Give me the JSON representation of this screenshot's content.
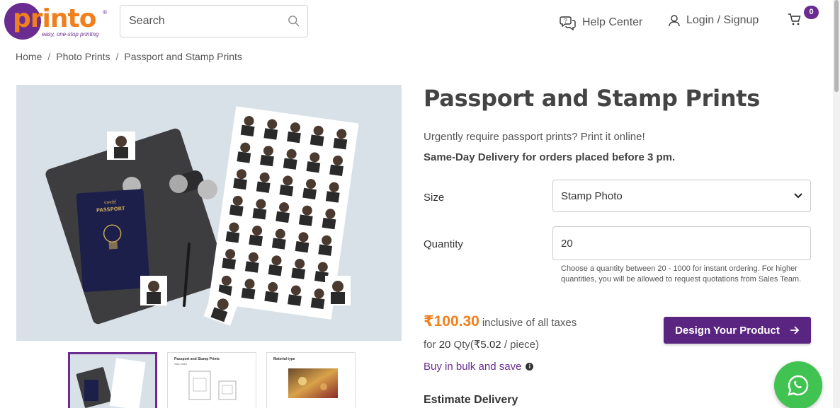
{
  "brand": {
    "logo_text": "printo",
    "tagline": "easy, one-stop printing",
    "logo_purple": "#6a2c91",
    "logo_orange": "#f07f1d"
  },
  "header": {
    "search_placeholder": "Search",
    "help_label": "Help Center",
    "login_label": "Login / Signup",
    "cart_count": "0"
  },
  "breadcrumb": {
    "items": [
      "Home",
      "Photo Prints",
      "Passport and Stamp Prints"
    ],
    "separator": "/"
  },
  "gallery": {
    "hero_alt": "passport photos sheet with passport and notebook",
    "passport_lines": [
      "पासपोर्ट",
      "PASSPORT"
    ],
    "thumbnails": [
      {
        "title": "",
        "subtitle": ""
      },
      {
        "title": "Passport and Stamp Prints",
        "subtitle": "Size chart"
      },
      {
        "title": "Material type",
        "subtitle": ""
      }
    ]
  },
  "product": {
    "title": "Passport and Stamp Prints",
    "description": "Urgently require passport prints? Print it online!",
    "delivery_note": "Same-Day Delivery for orders placed before 3 pm.",
    "size_label": "Size",
    "size_value": "Stamp Photo",
    "quantity_label": "Quantity",
    "quantity_value": "20",
    "quantity_hint": "Choose a quantity between 20 - 1000 for instant ordering. For higher quantities, you will be allowed to request quotations from Sales Team.",
    "price": "₹100.30",
    "price_note": "inclusive of all taxes",
    "per_prefix": "for",
    "per_qty": "20",
    "per_qty_unit": "Qty",
    "per_piece_open": "(",
    "per_piece_price": "₹5.02",
    "per_piece_suffix": "/ piece)",
    "bulk_label": "Buy in bulk and save",
    "design_button": "Design Your Product",
    "estimate_heading": "Estimate Delivery"
  },
  "colors": {
    "accent_purple": "#5a2481",
    "price_orange": "#f07f1d",
    "whatsapp_green": "#40c351"
  }
}
